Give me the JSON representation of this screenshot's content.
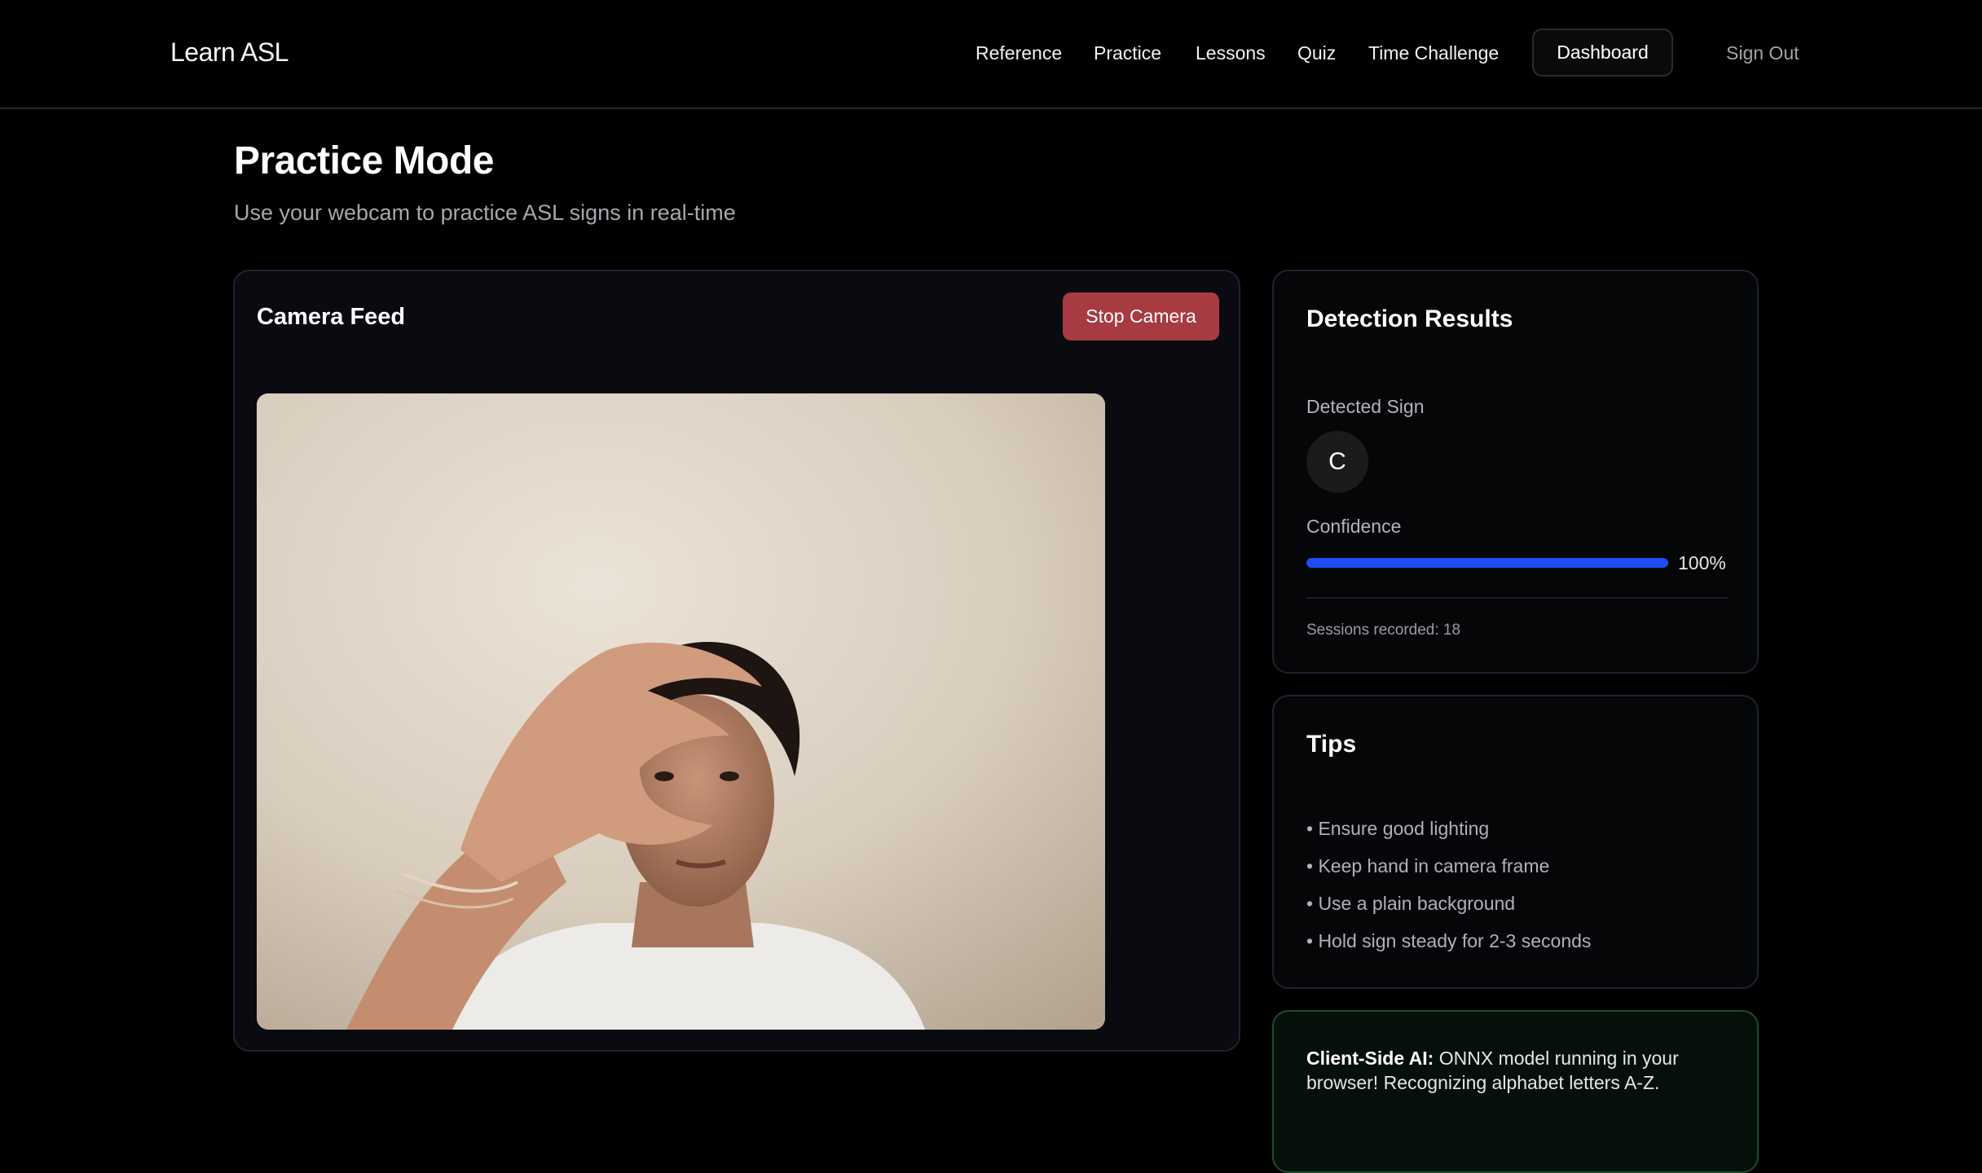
{
  "app": {
    "brand": "Learn ASL"
  },
  "nav": {
    "reference": "Reference",
    "practice": "Practice",
    "lessons": "Lessons",
    "quiz": "Quiz",
    "time_challenge": "Time Challenge",
    "dashboard": "Dashboard",
    "sign_out": "Sign Out"
  },
  "page": {
    "title": "Practice Mode",
    "subtitle": "Use your webcam to practice ASL signs in real-time"
  },
  "camera": {
    "title": "Camera Feed",
    "stop_label": "Stop Camera"
  },
  "results": {
    "title": "Detection Results",
    "detected_label": "Detected Sign",
    "detected_value": "C",
    "confidence_label": "Confidence",
    "confidence_value": 1.0,
    "confidence_text": "100%",
    "sessions_text": "Sessions recorded: 18"
  },
  "tips": {
    "title": "Tips",
    "items": [
      "• Ensure good lighting",
      "• Keep hand in camera frame",
      "• Use a plain background",
      "• Hold sign steady for 2-3 seconds"
    ]
  },
  "ai_note": {
    "bold": "Client-Side AI:",
    "text": " ONNX model running in your browser! Recognizing alphabet letters A-Z."
  },
  "colors": {
    "accent_blue": "#1d4ef5",
    "stop_red": "#a83a42",
    "ai_border_green": "#1a4d2a"
  }
}
